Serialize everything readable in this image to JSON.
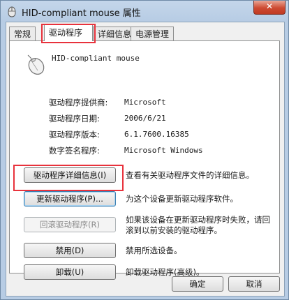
{
  "window": {
    "title": "HID-compliant mouse 属性",
    "close_label": "✕"
  },
  "tabs": [
    {
      "label": "常规",
      "active": false
    },
    {
      "label": "驱动程序",
      "active": true
    },
    {
      "label": "详细信息",
      "active": false
    },
    {
      "label": "电源管理",
      "active": false
    }
  ],
  "device": {
    "name": "HID-compliant mouse",
    "icon": "mouse-icon"
  },
  "properties": [
    {
      "label": "驱动程序提供商:",
      "value": "Microsoft"
    },
    {
      "label": "驱动程序日期:",
      "value": "2006/6/21"
    },
    {
      "label": "驱动程序版本:",
      "value": "6.1.7600.16385"
    },
    {
      "label": "数字签名程序:",
      "value": "Microsoft Windows"
    }
  ],
  "actions": [
    {
      "button": "驱动程序详细信息(I)",
      "desc": "查看有关驱动程序文件的详细信息。",
      "enabled": true
    },
    {
      "button": "更新驱动程序(P)...",
      "desc": "为这个设备更新驱动程序软件。",
      "enabled": true
    },
    {
      "button": "回滚驱动程序(R)",
      "desc": "如果该设备在更新驱动程序时失败，请回滚到以前安装的驱动程序。",
      "enabled": false
    },
    {
      "button": "禁用(D)",
      "desc": "禁用所选设备。",
      "enabled": true
    },
    {
      "button": "卸载(U)",
      "desc": "卸载驱动程序(高级)。",
      "enabled": true
    }
  ],
  "footer": {
    "ok_label": "确定",
    "cancel_label": "取消"
  },
  "colors": {
    "highlight_box": "#e8323c",
    "close_button": "#c03a22"
  }
}
